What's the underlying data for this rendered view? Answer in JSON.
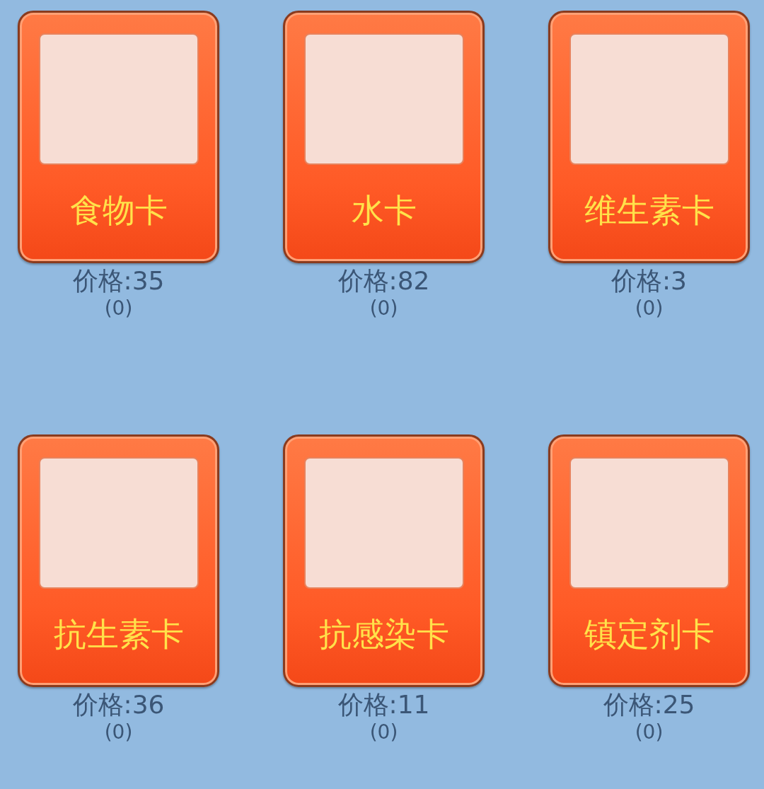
{
  "cards": [
    {
      "title": "食物卡",
      "price": "价格:35",
      "count": "(0)"
    },
    {
      "title": "水卡",
      "price": "价格:82",
      "count": "(0)"
    },
    {
      "title": "维生素卡",
      "price": "价格:3",
      "count": "(0)"
    },
    {
      "title": "抗生素卡",
      "price": "价格:36",
      "count": "(0)"
    },
    {
      "title": "抗感染卡",
      "price": "价格:11",
      "count": "(0)"
    },
    {
      "title": "镇定剂卡",
      "price": "价格:25",
      "count": "(0)"
    }
  ]
}
